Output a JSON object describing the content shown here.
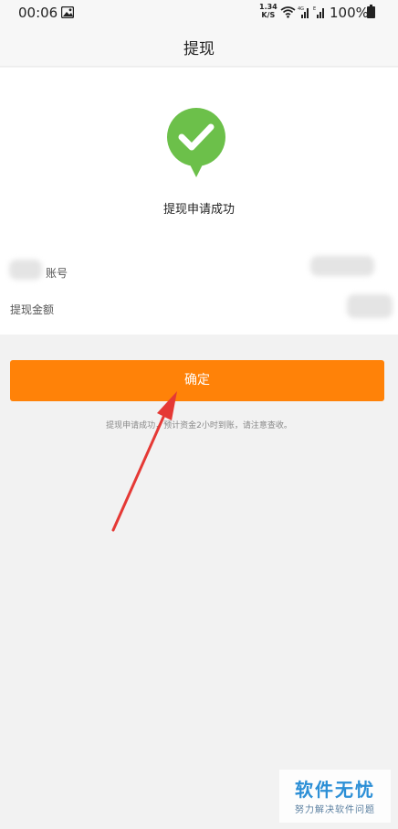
{
  "status_bar": {
    "time": "00:06",
    "speed_value": "1.34",
    "speed_unit": "K/S",
    "battery": "100%"
  },
  "header": {
    "title": "提现"
  },
  "result": {
    "message": "提现申请成功",
    "account_label": "账号",
    "amount_label": "提现金额"
  },
  "confirm_label": "确定",
  "notice": "提现申请成功，预计资金2小时到账，请注意查收。",
  "watermark": {
    "title": "软件无忧",
    "subtitle": "努力解决软件问题"
  },
  "colors": {
    "accent": "#ff8208",
    "success": "#6cc04a",
    "annotation_arrow": "#e53935"
  }
}
